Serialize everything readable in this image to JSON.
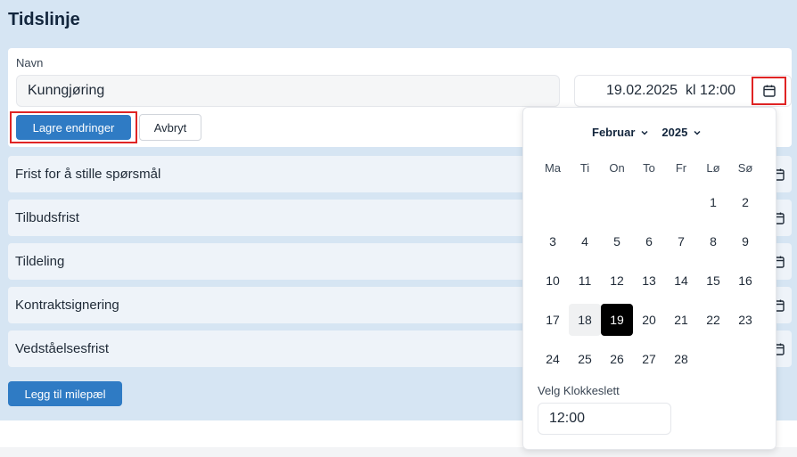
{
  "page": {
    "title": "Tidslinje"
  },
  "form": {
    "name_label": "Navn",
    "name_value": "Kunngjøring",
    "date_value": "19.02.2025  kl 12:00",
    "save_label": "Lagre endringer",
    "cancel_label": "Avbryt"
  },
  "milestones": [
    {
      "label": "Frist for å stille spørsmål"
    },
    {
      "label": "Tilbudsfrist"
    },
    {
      "label": "Tildeling"
    },
    {
      "label": "Kontraktsignering"
    },
    {
      "label": "Vedståelsesfrist"
    }
  ],
  "add_label": "Legg til milepæl",
  "datepicker": {
    "month": "Februar",
    "year": "2025",
    "weekdays": [
      "Ma",
      "Ti",
      "On",
      "To",
      "Fr",
      "Lø",
      "Sø"
    ],
    "days": [
      "1",
      "2",
      "3",
      "4",
      "5",
      "6",
      "7",
      "8",
      "9",
      "10",
      "11",
      "12",
      "13",
      "14",
      "15",
      "16",
      "17",
      "18",
      "19",
      "20",
      "21",
      "22",
      "23",
      "24",
      "25",
      "26",
      "27",
      "28"
    ],
    "first_weekday_index": 5,
    "today_day": "18",
    "selected_day": "19",
    "time_label": "Velg Klokkeslett",
    "time_value": "12:00"
  },
  "colors": {
    "primary": "#2f7bc4",
    "highlight_frame": "#e02424",
    "panel_bg": "#d6e5f3"
  }
}
